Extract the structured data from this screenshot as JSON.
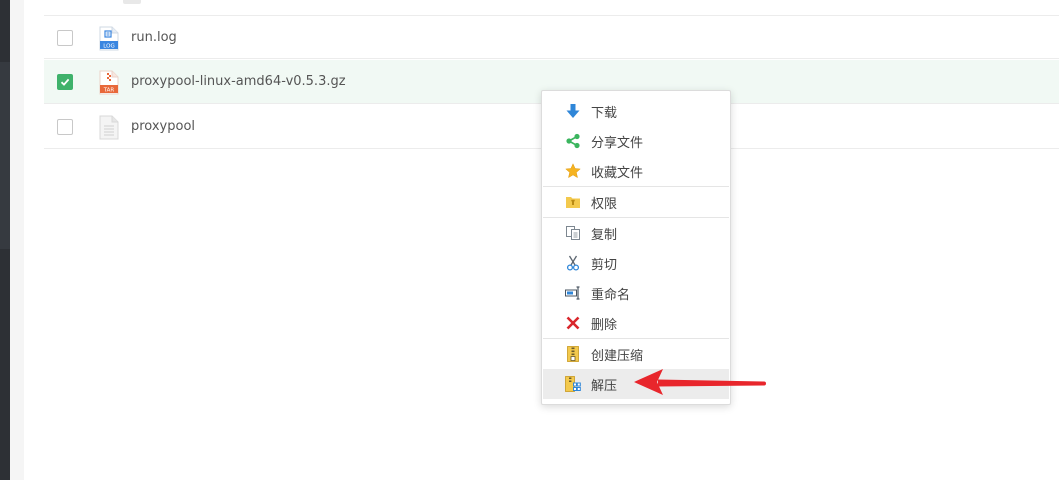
{
  "files": [
    {
      "name": "run.log",
      "checked": false,
      "icon": "log-file-icon",
      "icon_label": "LOG"
    },
    {
      "name": "proxypool-linux-amd64-v0.5.3.gz",
      "checked": true,
      "icon": "tar-archive-file-icon",
      "icon_label": "TAR"
    },
    {
      "name": "proxypool",
      "checked": false,
      "icon": "generic-file-icon",
      "icon_label": ""
    }
  ],
  "context_menu": {
    "items": [
      {
        "label": "下载",
        "icon": "download-arrow-icon"
      },
      {
        "label": "分享文件",
        "icon": "share-icon"
      },
      {
        "label": "收藏文件",
        "icon": "star-icon"
      },
      {
        "label": "权限",
        "icon": "permission-folder-icon"
      },
      {
        "label": "复制",
        "icon": "copy-icon"
      },
      {
        "label": "剪切",
        "icon": "scissors-icon"
      },
      {
        "label": "重命名",
        "icon": "rename-icon"
      },
      {
        "label": "删除",
        "icon": "delete-x-icon"
      },
      {
        "label": "创建压缩",
        "icon": "compress-zip-icon"
      },
      {
        "label": "解压",
        "icon": "extract-zip-icon"
      }
    ],
    "highlighted": "解压"
  },
  "colors": {
    "selected_row_bg": "#f1f9f4",
    "checkbox_checked": "#3fb26b",
    "annotation_arrow": "#e8262c",
    "menu_hover_bg": "#ececec"
  }
}
